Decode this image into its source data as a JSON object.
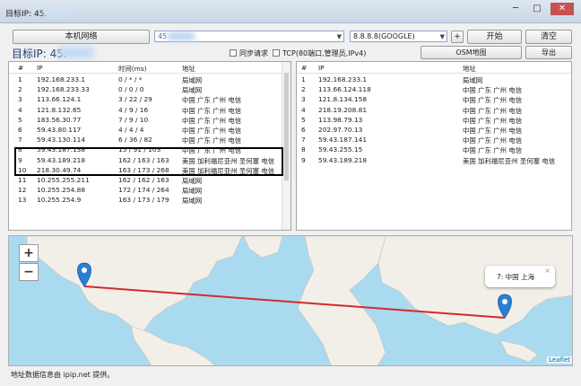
{
  "window": {
    "title": "目标IP: 45.",
    "minimize": "─",
    "maximize": "□",
    "close": "✕"
  },
  "toolbar": {
    "local_network_label": "本机网络",
    "target_input_value": "45",
    "dns_select_value": "8.8.8.8(GOOGLE)",
    "add_label": "+",
    "start_label": "开始",
    "clear_label": "清空",
    "osm_label": "OSM地图",
    "export_label": "导出"
  },
  "target_heading": "目标IP: 45.",
  "options": {
    "sync_request": "同步请求",
    "tcp_option": "TCP(80端口,管理员,IPv4)"
  },
  "left_table": {
    "headers": {
      "num": "#",
      "ip": "IP",
      "time": "时间(ms)",
      "location": "地址"
    },
    "rows": [
      {
        "num": "1",
        "ip": "192.168.233.1",
        "time": "0 / * / *",
        "loc": "局域网"
      },
      {
        "num": "2",
        "ip": "192.168.233.33",
        "time": "0 / 0 / 0",
        "loc": "局域网"
      },
      {
        "num": "3",
        "ip": "113.66.124.1",
        "time": "3 / 22 / 29",
        "loc": "中国 广东 广州 电信"
      },
      {
        "num": "4",
        "ip": "121.8.132.65",
        "time": "4 / 9 / 16",
        "loc": "中国 广东 广州 电信"
      },
      {
        "num": "5",
        "ip": "183.56.30.77",
        "time": "7 / 9 / 10",
        "loc": "中国 广东 广州 电信"
      },
      {
        "num": "6",
        "ip": "59.43.80.117",
        "time": "4 / 4 / 4",
        "loc": "中国 广东 广州 电信"
      },
      {
        "num": "7",
        "ip": "59.43.130.114",
        "time": "6 / 36 / 82",
        "loc": "中国 广东 广州 电信"
      },
      {
        "num": "8",
        "ip": "59.43.187.138",
        "time": "15 / 91 / 103",
        "loc": "中国 广东 广州 电信"
      },
      {
        "num": "9",
        "ip": "59.43.189.218",
        "time": "162 / 163 / 163",
        "loc": "美国 加利福尼亚州 圣何塞 电信"
      },
      {
        "num": "10",
        "ip": "218.30.49.74",
        "time": "163 / 173 / 268",
        "loc": "美国 加利福尼亚州 圣何塞 电信"
      },
      {
        "num": "11",
        "ip": "10.255.255.211",
        "time": "162 / 162 / 163",
        "loc": "局域网"
      },
      {
        "num": "12",
        "ip": "10.255.254.88",
        "time": "172 / 174 / 264",
        "loc": "局域网"
      },
      {
        "num": "13",
        "ip": "10.255.254.9",
        "time": "163 / 173 / 179",
        "loc": "局域网"
      }
    ]
  },
  "right_table": {
    "headers": {
      "num": "#",
      "ip": "IP",
      "location": "地址"
    },
    "rows": [
      {
        "num": "1",
        "ip": "192.168.233.1",
        "loc": "局域网"
      },
      {
        "num": "2",
        "ip": "113.66.124.118",
        "loc": "中国 广东 广州 电信"
      },
      {
        "num": "3",
        "ip": "121.8.134.158",
        "loc": "中国 广东 广州 电信"
      },
      {
        "num": "4",
        "ip": "218.19.208.81",
        "loc": "中国 广东 广州 电信"
      },
      {
        "num": "5",
        "ip": "113.98.79.13",
        "loc": "中国 广东 广州 电信"
      },
      {
        "num": "6",
        "ip": "202.97.70.13",
        "loc": "中国 广东 广州 电信"
      },
      {
        "num": "7",
        "ip": "59.43.187.141",
        "loc": "中国 广东 广州 电信"
      },
      {
        "num": "8",
        "ip": "59.43.255.15",
        "loc": "中国 广东 广州 电信"
      },
      {
        "num": "9",
        "ip": "59.43.189.218",
        "loc": "美国 加利福尼亚州 圣何塞 电信"
      }
    ]
  },
  "map": {
    "zoom_in": "+",
    "zoom_out": "−",
    "popup_text": "7: 中国 上海",
    "popup_close": "×",
    "attribution": "Leaflet",
    "route_color": "#d22a2a",
    "marker_color": "#2a7fd4"
  },
  "footer": {
    "text": "地址数据信息由 ipip.net 提供。"
  },
  "highlight_color": "#000000"
}
